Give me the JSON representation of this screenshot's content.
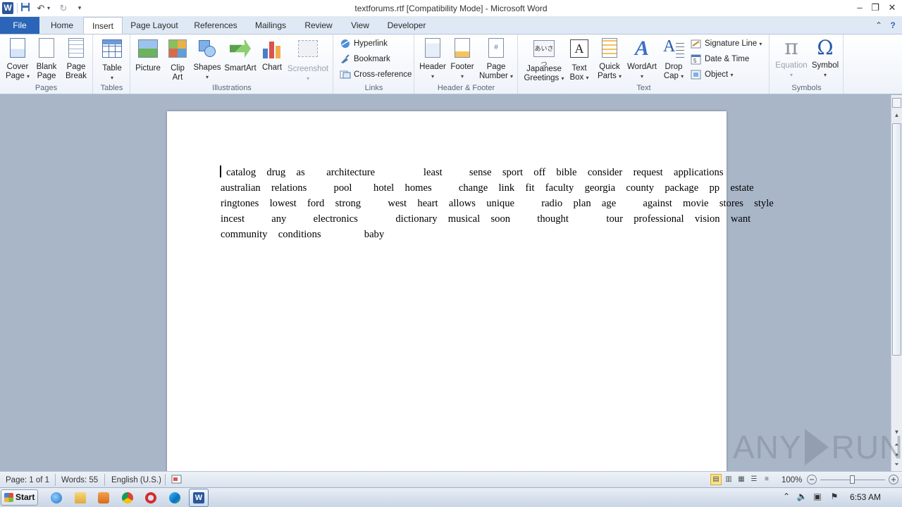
{
  "window": {
    "title": "textforums.rtf [Compatibility Mode] - Microsoft Word",
    "app_icon_letter": "W"
  },
  "quick_access": {
    "save_icon": "save-icon",
    "undo_icon": "undo-icon",
    "redo_icon": "redo-icon",
    "customize_icon": "customize-qat-icon"
  },
  "tabs": [
    {
      "label": "File"
    },
    {
      "label": "Home"
    },
    {
      "label": "Insert"
    },
    {
      "label": "Page Layout"
    },
    {
      "label": "References"
    },
    {
      "label": "Mailings"
    },
    {
      "label": "Review"
    },
    {
      "label": "View"
    },
    {
      "label": "Developer"
    }
  ],
  "active_tab": "Insert",
  "ribbon": {
    "pages": {
      "label": "Pages",
      "cover_page": [
        "Cover",
        "Page"
      ],
      "blank_page": [
        "Blank",
        "Page"
      ],
      "page_break": [
        "Page",
        "Break"
      ]
    },
    "tables": {
      "label": "Tables",
      "table": "Table"
    },
    "illustrations": {
      "label": "Illustrations",
      "picture": "Picture",
      "clip_art": [
        "Clip",
        "Art"
      ],
      "shapes": "Shapes",
      "smartart": "SmartArt",
      "chart": "Chart",
      "screenshot": "Screenshot"
    },
    "links": {
      "label": "Links",
      "hyperlink": "Hyperlink",
      "bookmark": "Bookmark",
      "cross_reference": "Cross-reference"
    },
    "header_footer": {
      "label": "Header & Footer",
      "header": "Header",
      "footer": "Footer",
      "page_number": [
        "Page",
        "Number"
      ]
    },
    "text": {
      "label": "Text",
      "japanese_greetings": [
        "Japanese",
        "Greetings"
      ],
      "text_box": [
        "Text",
        "Box"
      ],
      "quick_parts": [
        "Quick",
        "Parts"
      ],
      "wordart": "WordArt",
      "drop_cap": [
        "Drop",
        "Cap"
      ],
      "signature_line": "Signature Line",
      "date_time": "Date & Time",
      "object": "Object"
    },
    "symbols": {
      "label": "Symbols",
      "equation": "Equation",
      "symbol": "Symbol"
    }
  },
  "document": {
    "lines": [
      "catalog  drug  as    architecture         least     sense  sport  off  bible  consider  request  applications",
      "australian  relations     pool    hotel  homes     change  link  fit  faculty  georgia  county  package  pp  estate",
      "ringtones  lowest  ford  strong     west  heart  allows  unique     radio  plan  age     against  movie  stores  style",
      "incest     any     electronics       dictionary  musical  soon     thought       tour  professional  vision  want",
      "community  conditions        baby"
    ]
  },
  "status_bar": {
    "page": "Page: 1 of 1",
    "words": "Words: 55",
    "language": "English (U.S.)",
    "zoom": "100%",
    "zoom_level_percent": 100
  },
  "taskbar": {
    "start_label": "Start",
    "apps": [
      "internet-explorer-icon",
      "file-explorer-icon",
      "media-player-icon",
      "chrome-icon",
      "opera-icon",
      "edge-icon",
      "word-icon"
    ],
    "clock": "6:53 AM"
  },
  "watermark": {
    "left": "ANY",
    "right": "RUN"
  },
  "colors": {
    "file_tab": "#2a65b7",
    "ribbon_bg": "#ffffff",
    "workspace": "#a9b6c8"
  }
}
